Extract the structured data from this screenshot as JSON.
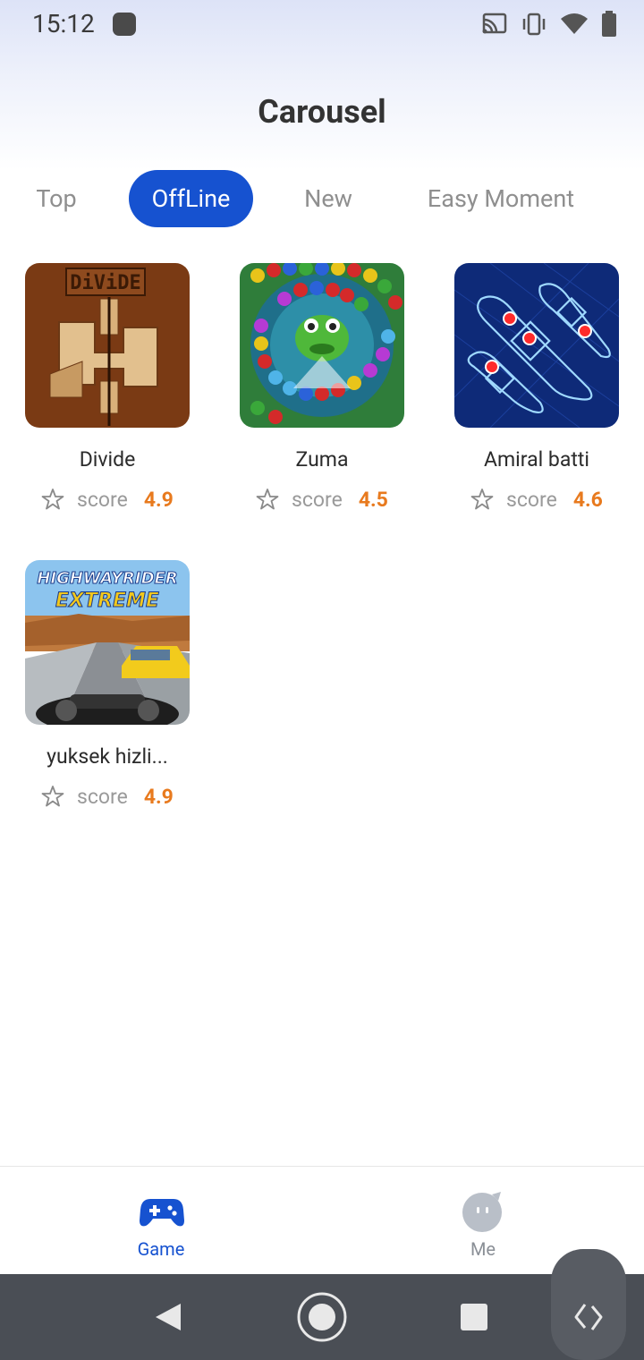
{
  "status_bar": {
    "time": "15:12"
  },
  "page": {
    "title": "Carousel"
  },
  "tabs": [
    {
      "label": "Top",
      "active": false
    },
    {
      "label": "OffLine",
      "active": true
    },
    {
      "label": "New",
      "active": false
    },
    {
      "label": "Easy Moment",
      "active": false
    }
  ],
  "games": [
    {
      "name": "Divide",
      "score_label": "score",
      "score": "4.9",
      "thumb_text": "DiViDE"
    },
    {
      "name": "Zuma",
      "score_label": "score",
      "score": "4.5"
    },
    {
      "name": "Amiral batti",
      "score_label": "score",
      "score": "4.6"
    },
    {
      "name": "yuksek hizli...",
      "score_label": "score",
      "score": "4.9",
      "thumb_text_1": "HIGHWAYRIDER",
      "thumb_text_2": "EXTREME"
    }
  ],
  "bottom_nav": [
    {
      "label": "Game",
      "active": true,
      "icon": "gamepad-icon"
    },
    {
      "label": "Me",
      "active": false,
      "icon": "face-icon"
    }
  ],
  "colors": {
    "accent": "#1652d0",
    "score": "#e87a1e"
  }
}
